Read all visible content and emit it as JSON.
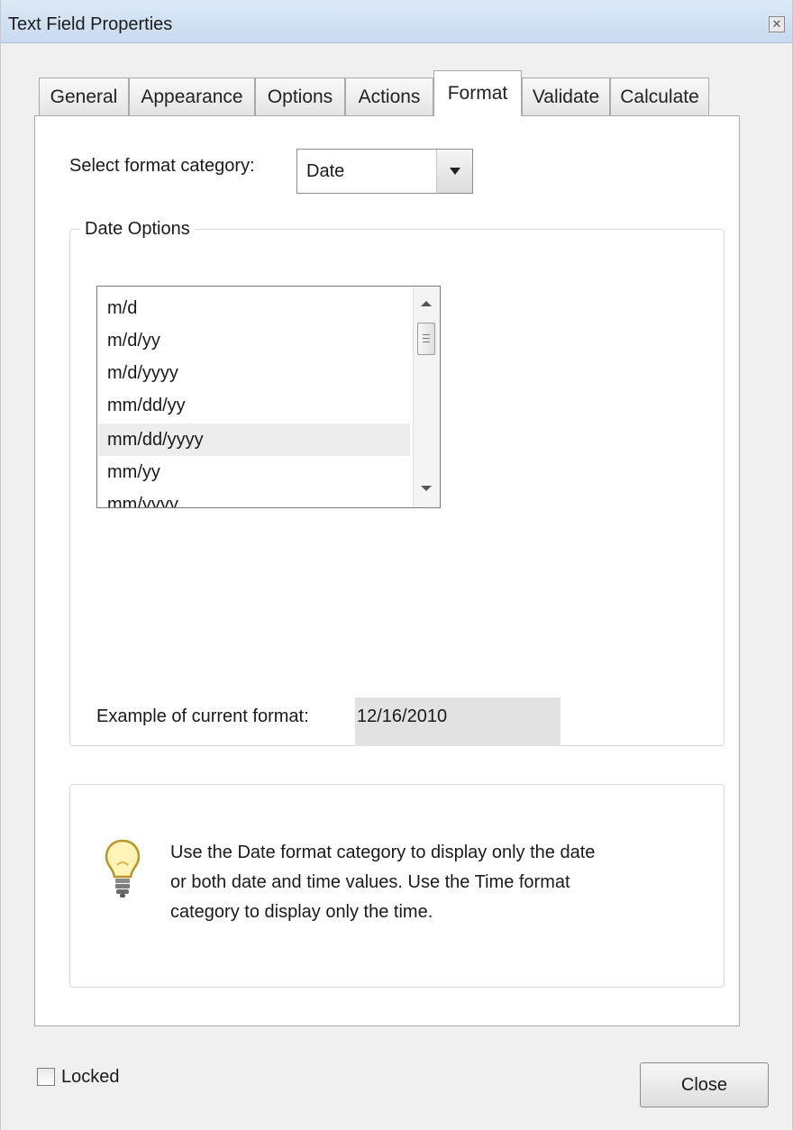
{
  "window": {
    "title": "Text Field Properties",
    "close_glyph": "✕"
  },
  "tabs": [
    {
      "label": "General"
    },
    {
      "label": "Appearance"
    },
    {
      "label": "Options"
    },
    {
      "label": "Actions"
    },
    {
      "label": "Format",
      "active": true
    },
    {
      "label": "Validate"
    },
    {
      "label": "Calculate"
    }
  ],
  "format": {
    "category_label": "Select format category:",
    "category_value": "Date"
  },
  "date_options": {
    "legend": "Date Options",
    "items": [
      "m/d",
      "m/d/yy",
      "m/d/yyyy",
      "mm/dd/yy",
      "mm/dd/yyyy",
      "mm/yy",
      "mm/yyyy"
    ],
    "selected": "mm/dd/yyyy"
  },
  "example": {
    "label": "Example of current format:",
    "value": "12/16/2010"
  },
  "info": {
    "icon": "lightbulb-icon",
    "lines": [
      "Use the Date format category to display only the date",
      "or both date and time values. Use the Time format",
      "category to display only the time."
    ]
  },
  "footer": {
    "locked_label": "Locked",
    "locked_checked": false,
    "close_label": "Close"
  }
}
